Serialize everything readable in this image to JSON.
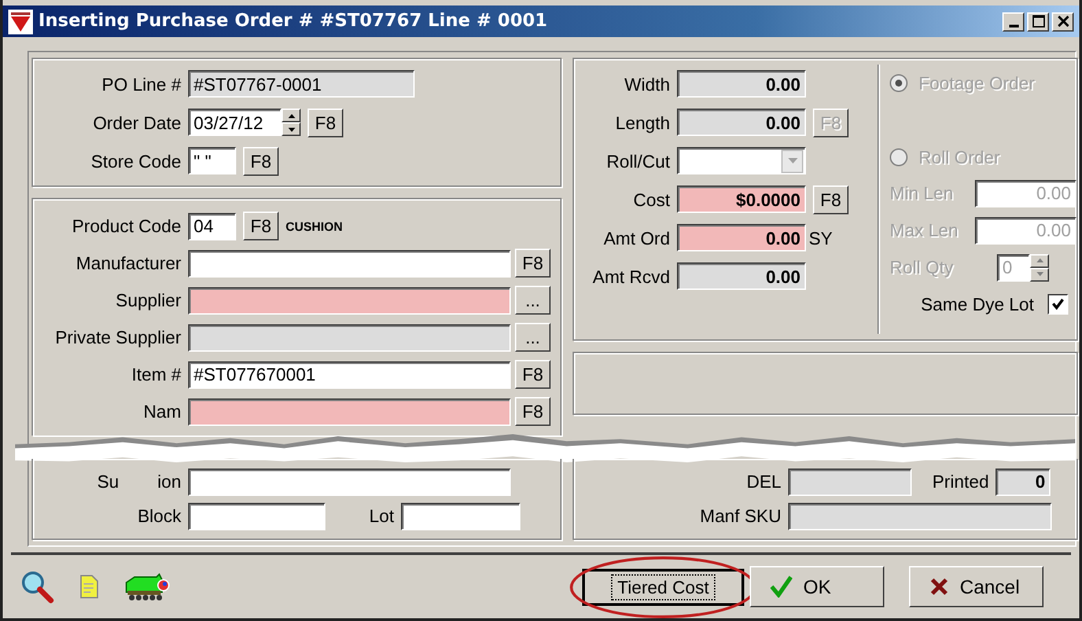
{
  "window": {
    "title": "Inserting Purchase Order # #ST07767  Line # 0001"
  },
  "header_group": {
    "rows": [
      {
        "label": "PO Line #",
        "value": "#ST07767-0001",
        "kind": "text",
        "readonly": true,
        "required": false
      },
      {
        "label": "Order Date",
        "value": "03/27/12",
        "kind": "date",
        "readonly": false,
        "required": false,
        "button": "F8"
      },
      {
        "label": "Store Code",
        "value": "\" \"",
        "kind": "text",
        "readonly": false,
        "required": false,
        "button": "F8"
      }
    ]
  },
  "product_group": {
    "rows": [
      {
        "label": "Product Code",
        "value": "04",
        "readonly": false,
        "required": false,
        "button": "F8",
        "note": "CUSHION"
      },
      {
        "label": "Manufacturer",
        "readonly": false,
        "required": false,
        "button": "F8"
      },
      {
        "label": "Supplier",
        "readonly": false,
        "required": true,
        "button": "..."
      },
      {
        "label": "Private Supplier",
        "readonly": true,
        "required": false,
        "button": "..."
      },
      {
        "label": "Item #",
        "value": "#ST077670001",
        "readonly": false,
        "required": false,
        "button": "F8"
      },
      {
        "label": "Nam",
        "readonly": false,
        "required": true,
        "button": "F8"
      }
    ],
    "substitution_label_parts": [
      "Su",
      "ion"
    ],
    "block_label": "Block",
    "lot_label": "Lot"
  },
  "measure_group": {
    "rows": [
      {
        "label": "Width",
        "value": "0.00",
        "kind": "text",
        "readonly": true,
        "required": false
      },
      {
        "label": "Length",
        "value": "0.00",
        "kind": "text",
        "readonly": true,
        "required": false,
        "button": "F8",
        "button_disabled": true
      },
      {
        "label": "Roll/Cut",
        "kind": "dropdown",
        "readonly": false,
        "required": false
      },
      {
        "label": "Cost",
        "value": "$0.0000",
        "kind": "text",
        "readonly": false,
        "required": true,
        "button": "F8",
        "button_disabled": false
      },
      {
        "label": "Amt Ord",
        "value": "0.00",
        "kind": "text",
        "readonly": false,
        "required": true,
        "suffix": "SY"
      },
      {
        "label": "Amt Rcvd",
        "value": "0.00",
        "kind": "text",
        "readonly": true,
        "required": false
      }
    ]
  },
  "order_type": {
    "disabled": true,
    "radios": [
      {
        "label": "Footage Order",
        "selected": true
      },
      {
        "label": "Roll Order",
        "selected": false
      }
    ],
    "min_len": {
      "label": "Min Len",
      "value": "0.00"
    },
    "max_len": {
      "label": "Max Len",
      "value": "0.00"
    },
    "roll_qty": {
      "label": "Roll Qty",
      "value": "0"
    },
    "same_dye_lot": {
      "label": "Same Dye Lot",
      "checked": true
    }
  },
  "lower_right": {
    "del_label": "DEL",
    "printed_label": "Printed",
    "printed_value": "0",
    "manf_sku_label": "Manf SKU"
  },
  "buttons": [
    {
      "label": "Tiered Cost",
      "kind": "plain",
      "focused": true,
      "highlighted": true
    },
    {
      "label": "OK",
      "kind": "ok",
      "focused": false,
      "highlighted": false
    },
    {
      "label": "Cancel",
      "kind": "cancel",
      "focused": false,
      "highlighted": false
    }
  ]
}
